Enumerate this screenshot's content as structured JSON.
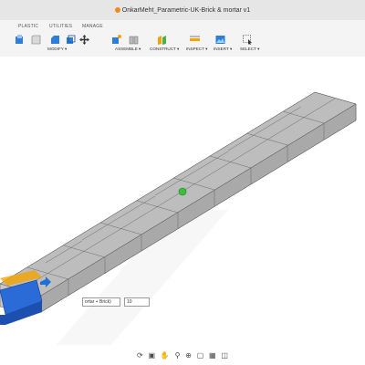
{
  "window": {
    "title": "OnkarMeht_Parametric-UK-Brick & mortar v1"
  },
  "tabs": [
    "PLASTIC",
    "UTILITIES",
    "MANAGE"
  ],
  "groups": [
    {
      "label": "MODIFY ▾"
    },
    {
      "label": "ASSEMBLE ▾"
    },
    {
      "label": "CONSTRUCT ▾"
    },
    {
      "label": "INSPECT ▾"
    },
    {
      "label": "INSERT ▾"
    },
    {
      "label": "SELECT ▾"
    }
  ],
  "input_chip": {
    "field_value": "ortar + Brick)",
    "count_value": "10"
  },
  "navbar_icons": [
    "orbit-icon",
    "look-at-icon",
    "pan-icon",
    "zoom-icon",
    "zoom-window-icon",
    "display-settings-icon",
    "grid-icon",
    "viewports-icon"
  ],
  "colors": {
    "accent": "#1f6fd6",
    "selection_blue": "#2a6bd8",
    "pivot_green": "#3cbf3c",
    "mortar_orange": "#f4a300"
  }
}
